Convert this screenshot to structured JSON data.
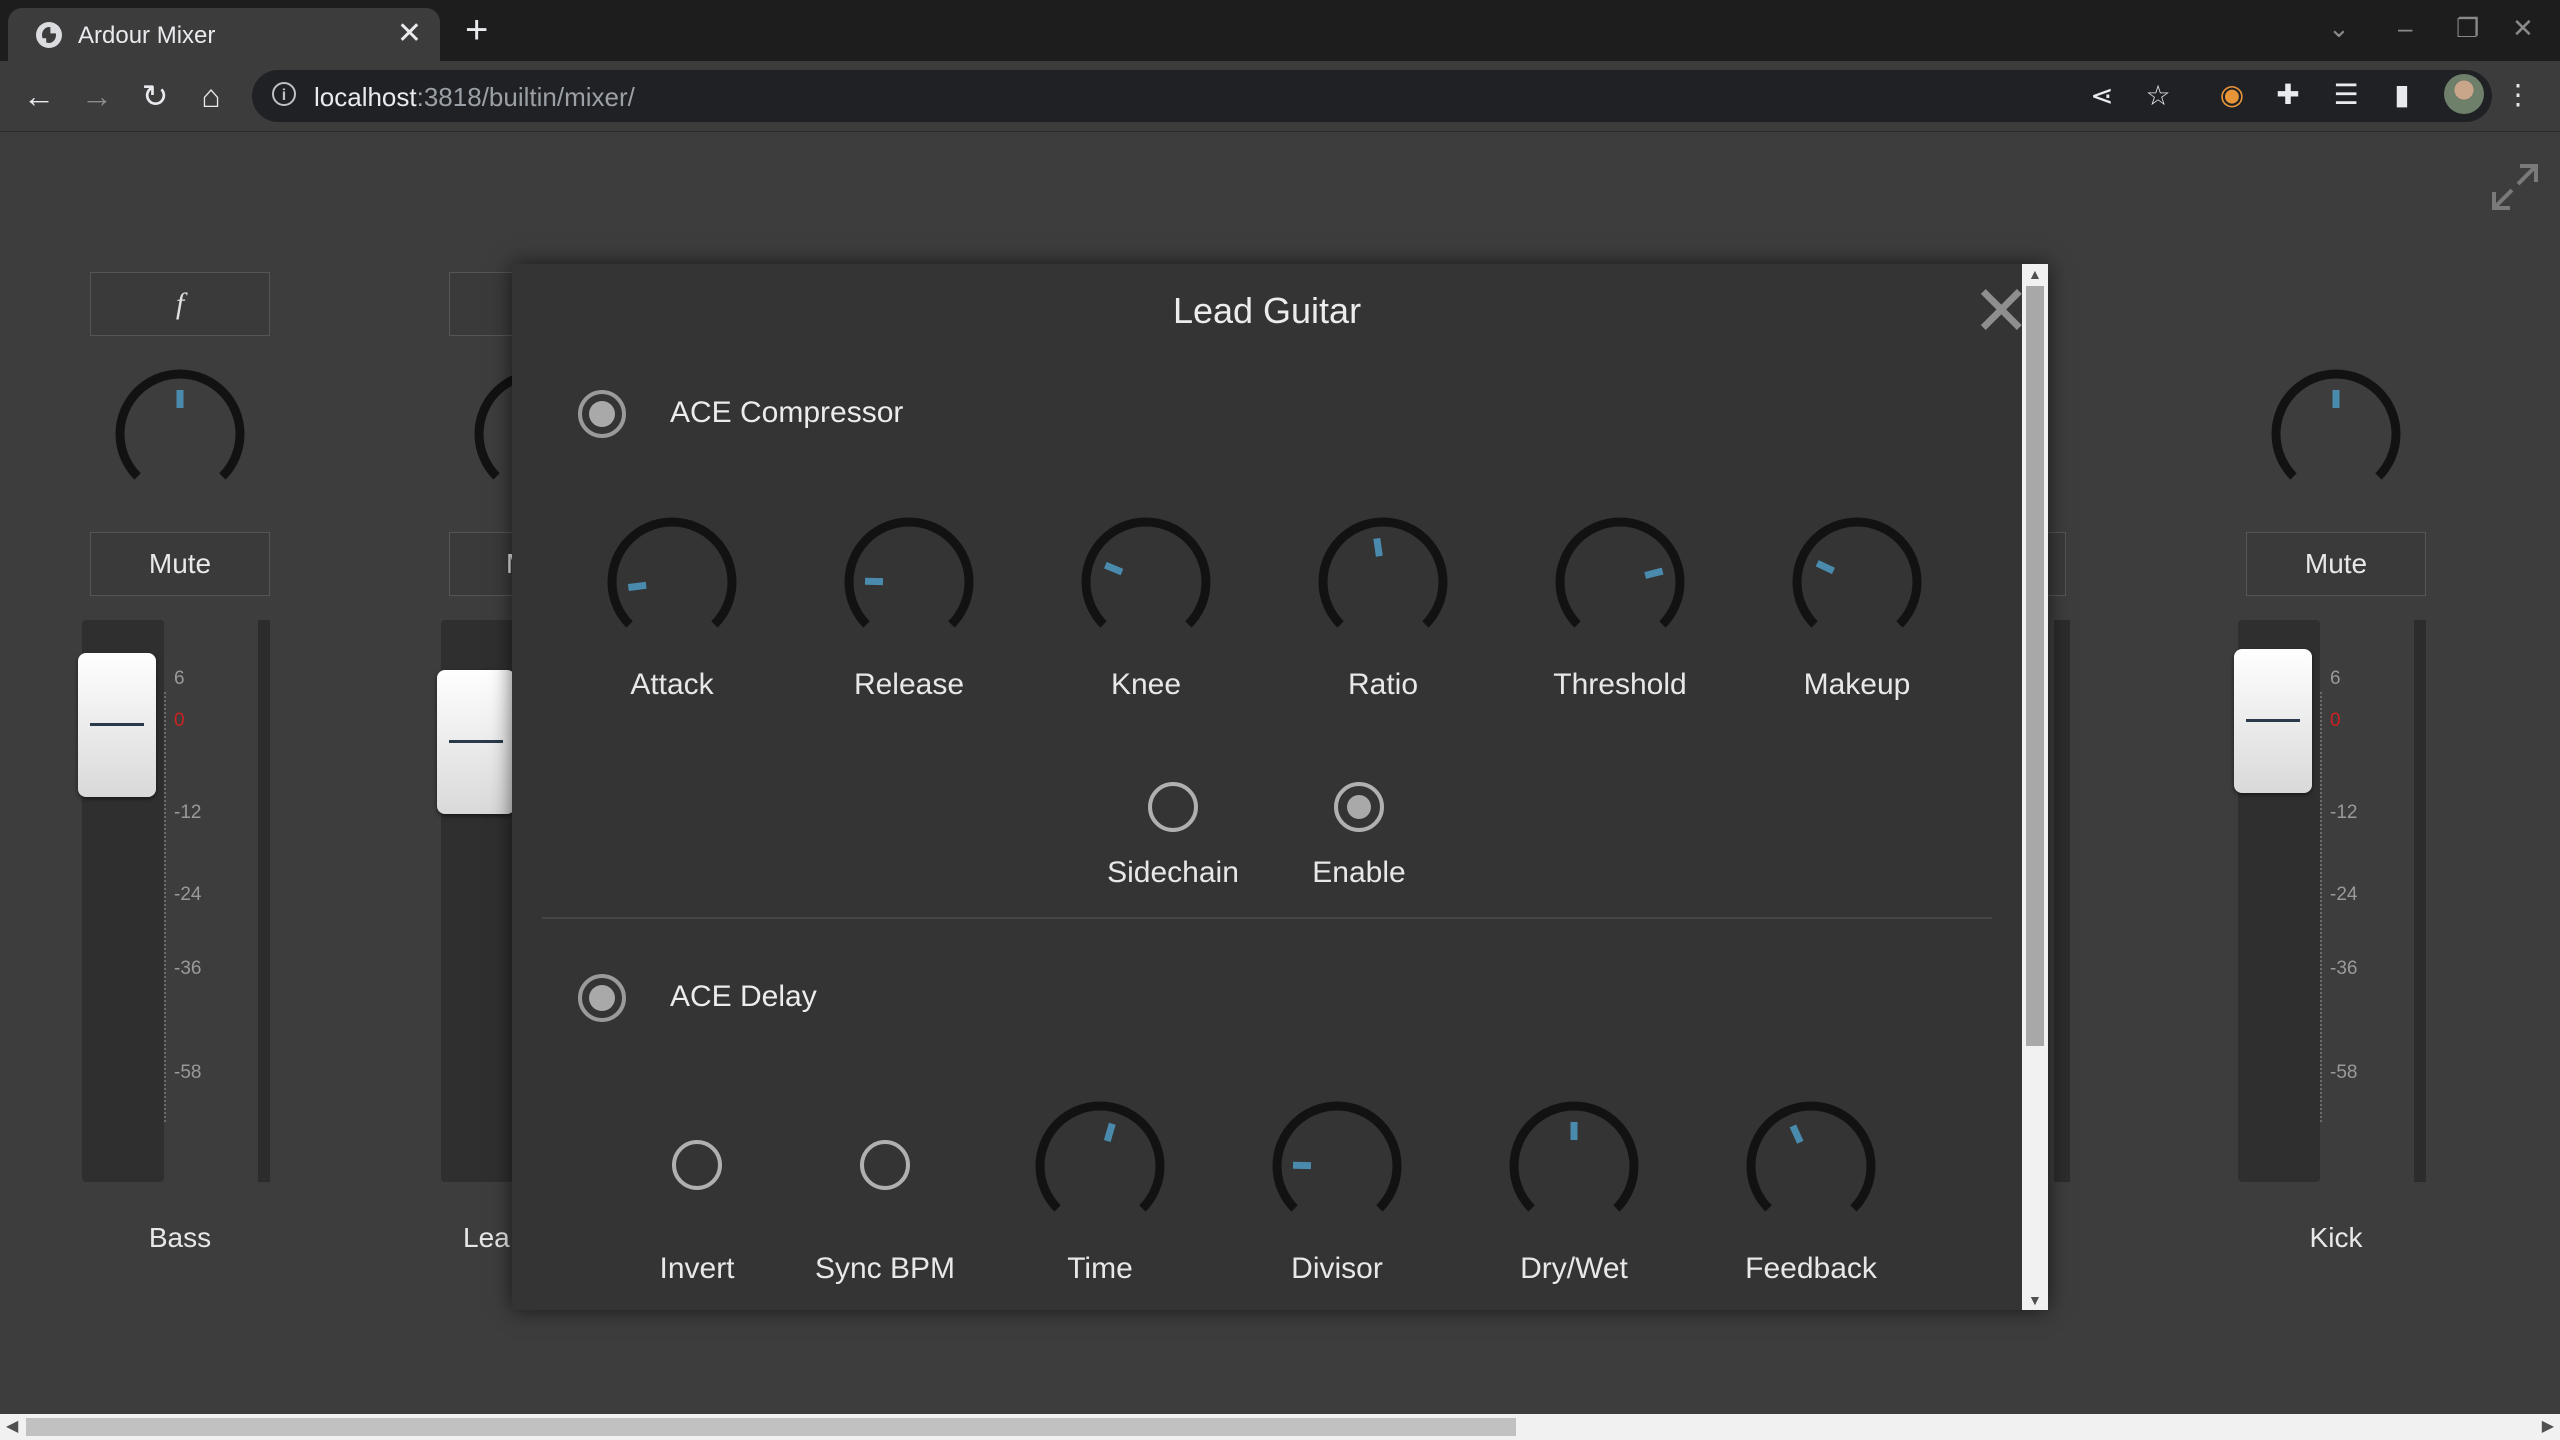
{
  "browser": {
    "tab_title": "Ardour Mixer",
    "url_host": "localhost",
    "url_rest": ":3818/builtin/mixer/"
  },
  "strips": [
    {
      "name_button": "f",
      "mute_label": "Mute",
      "label": "Bass",
      "fader_level": 0.92
    },
    {
      "name_button": "",
      "mute_label": "M",
      "label": "Lea",
      "fader_level": 0.88
    },
    {
      "name_button": "",
      "mute_label": "Mute",
      "label": "Kick",
      "fader_level": 0.93
    }
  ],
  "meter_scale": [
    "6",
    "0",
    "-12",
    "-24",
    "-36",
    "-58"
  ],
  "colors": {
    "accent": "#4a8aad",
    "zero_mark": "#cc2222"
  },
  "modal": {
    "title": "Lead Guitar",
    "plugins": [
      {
        "name": "ACE Compressor",
        "active": true,
        "knobs": [
          {
            "label": "Attack",
            "value": 0.14
          },
          {
            "label": "Release",
            "value": 0.17
          },
          {
            "label": "Knee",
            "value": 0.25
          },
          {
            "label": "Ratio",
            "value": 0.47
          },
          {
            "label": "Threshold",
            "value": 0.78
          },
          {
            "label": "Makeup",
            "value": 0.26
          }
        ],
        "toggles": [
          {
            "label": "Sidechain",
            "on": false
          },
          {
            "label": "Enable",
            "on": true
          }
        ]
      },
      {
        "name": "ACE Delay",
        "active": true,
        "toggles": [
          {
            "label": "Invert",
            "on": false
          },
          {
            "label": "Sync BPM",
            "on": false
          }
        ],
        "knobs": [
          {
            "label": "Time",
            "value": 0.56
          },
          {
            "label": "Divisor",
            "value": 0.17
          },
          {
            "label": "Dry/Wet",
            "value": 0.5
          },
          {
            "label": "Feedback",
            "value": 0.41
          }
        ]
      }
    ]
  }
}
